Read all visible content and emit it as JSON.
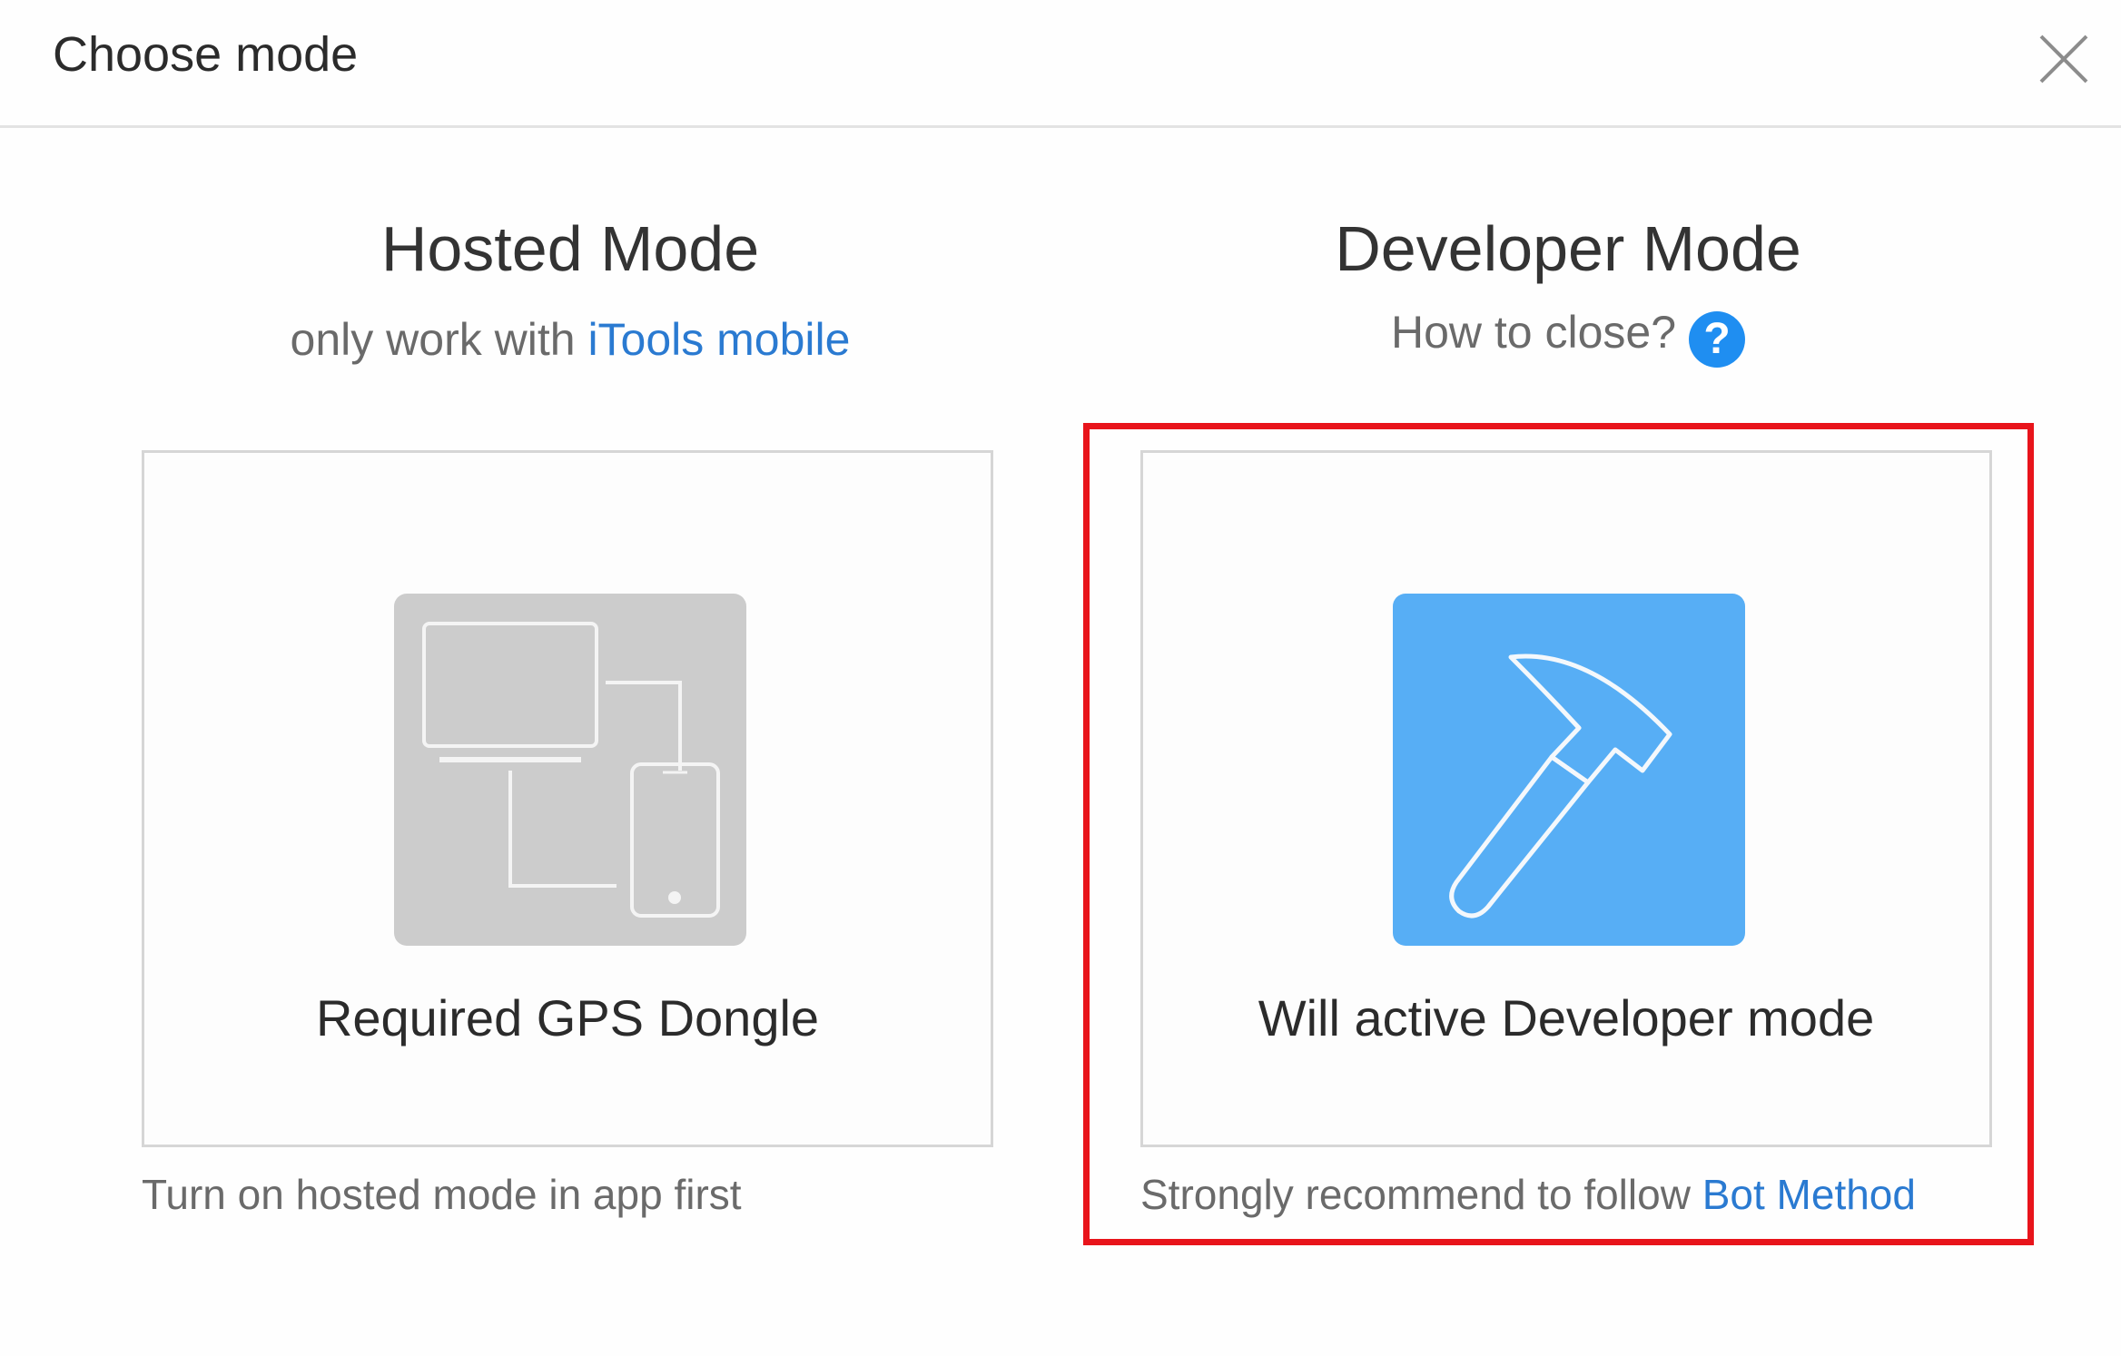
{
  "dialog": {
    "title": "Choose mode"
  },
  "hosted": {
    "title": "Hosted Mode",
    "subtitle_prefix": "only work with ",
    "subtitle_link": "iTools mobile",
    "card_label": "Required GPS Dongle",
    "footnote": "Turn on hosted mode in app first",
    "icon": "devices-icon",
    "icon_bg": "#cccccc"
  },
  "developer": {
    "title": "Developer Mode",
    "subtitle": "How to close?",
    "help_glyph": "?",
    "card_label": "Will active Developer mode",
    "footnote_prefix": "Strongly recommend to follow ",
    "footnote_link": "Bot Method",
    "icon": "hammer-icon",
    "icon_bg": "#57aef5"
  },
  "colors": {
    "link": "#2a7ad1",
    "help_icon": "#1f8ef1",
    "highlight": "#e8141b"
  }
}
